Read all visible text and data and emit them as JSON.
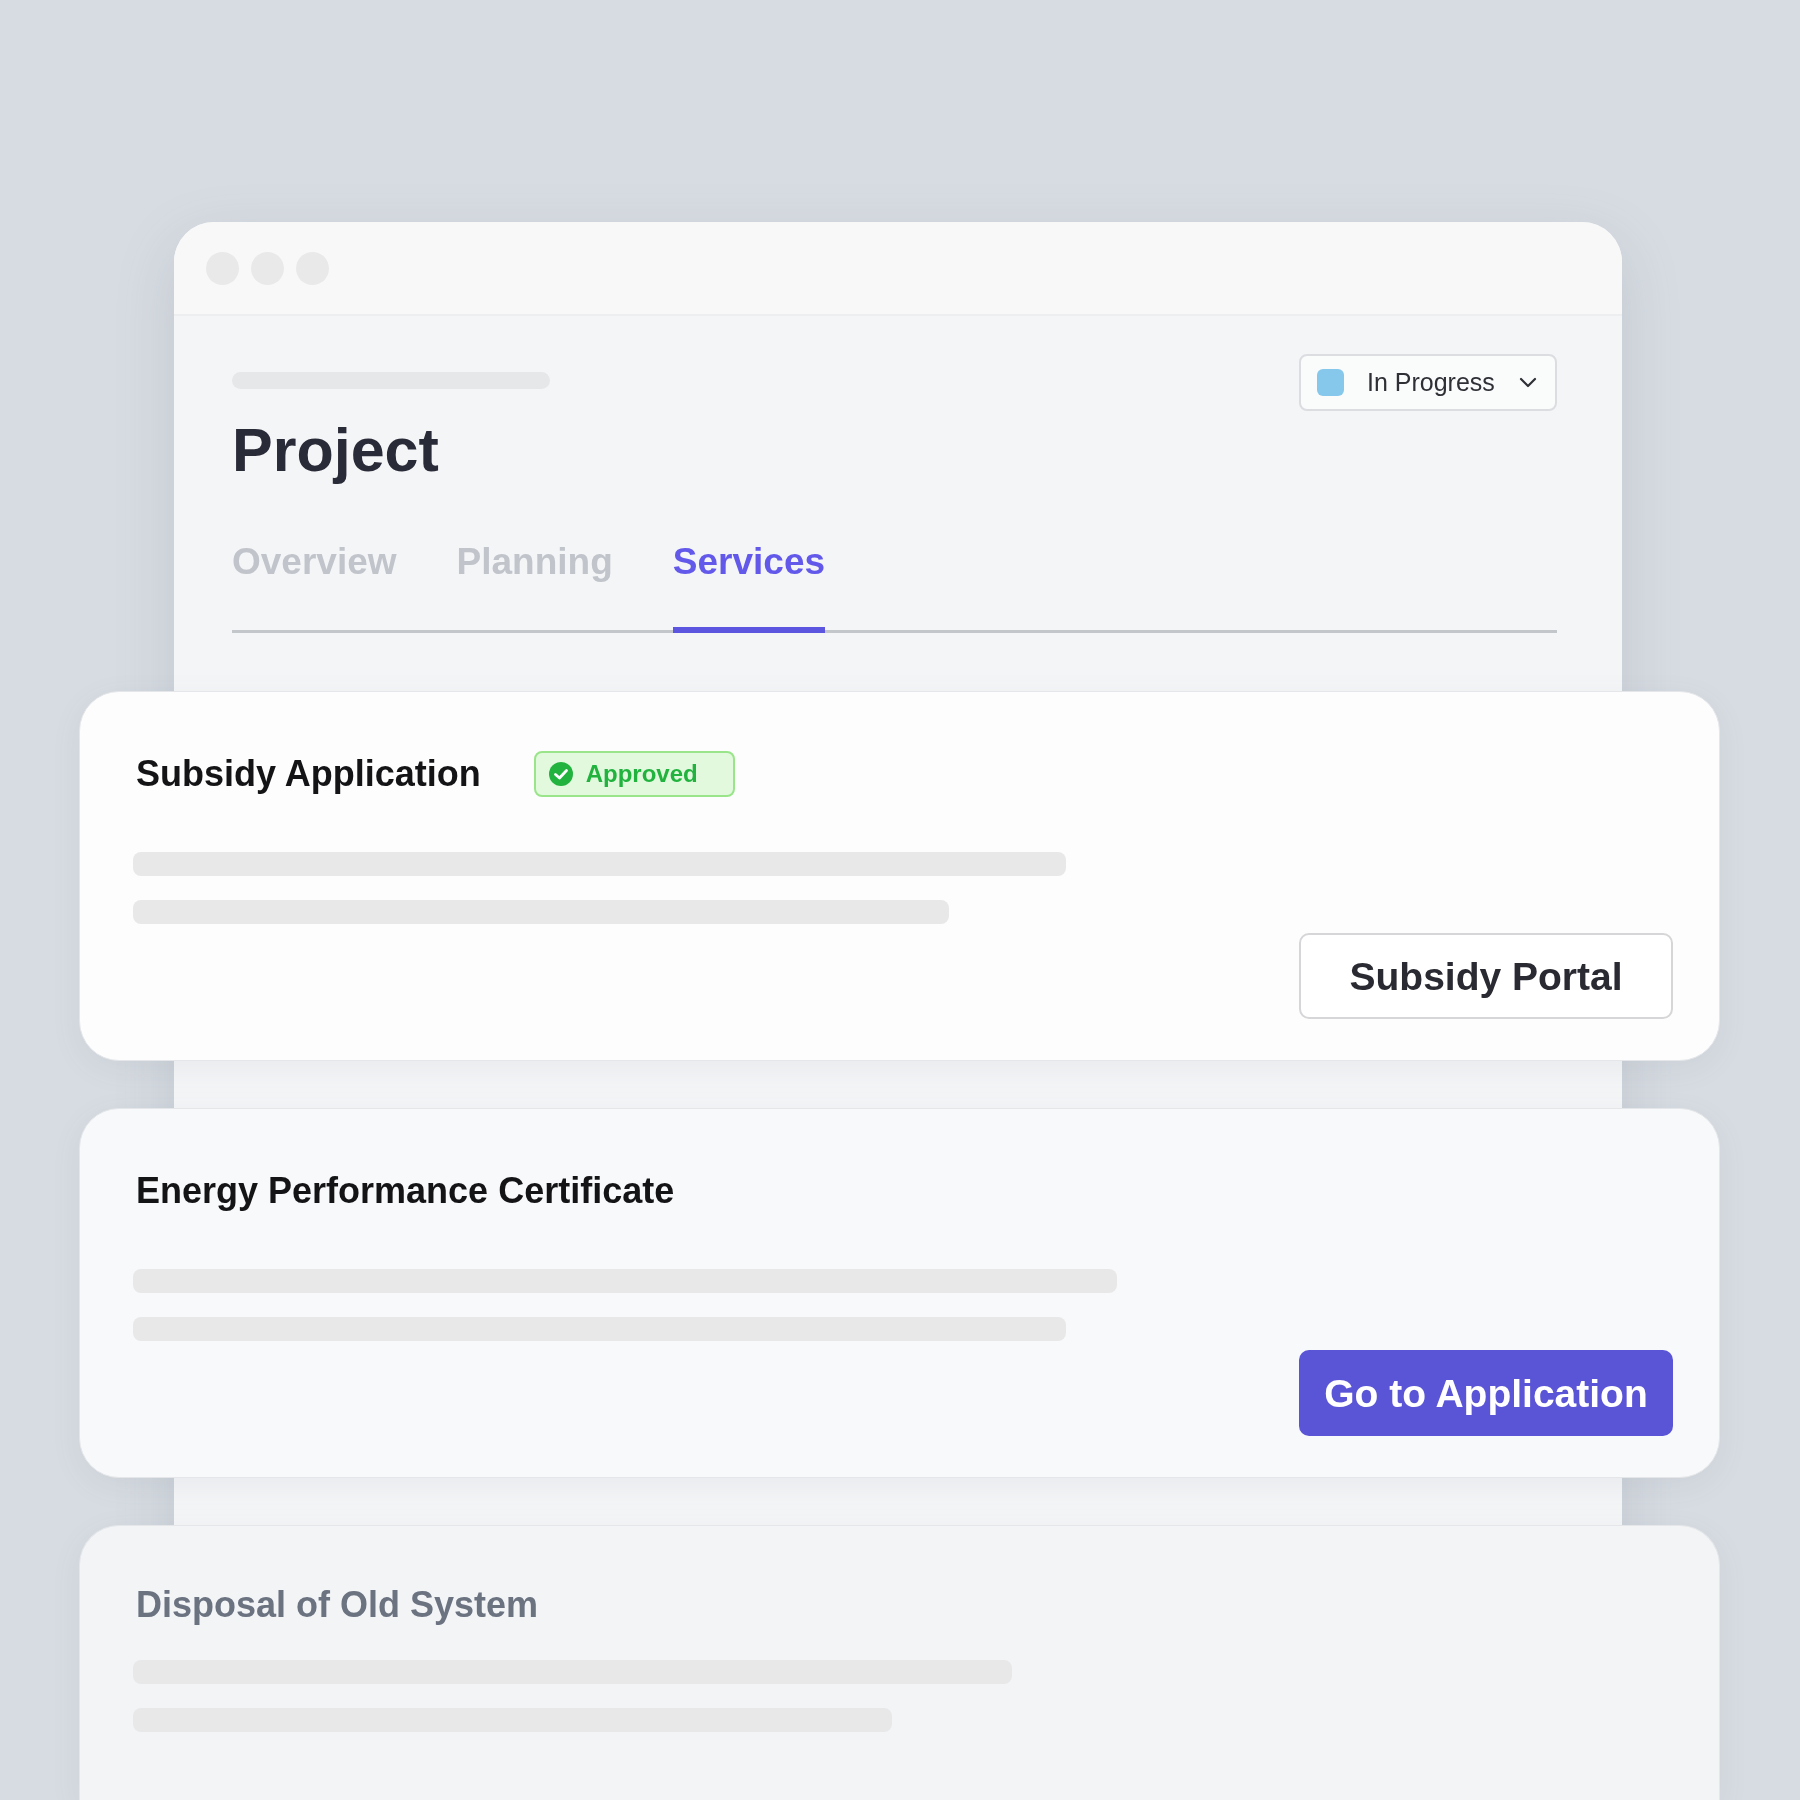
{
  "page": {
    "title": "Project",
    "status": {
      "label": "In Progress",
      "color": "#86c8ec"
    },
    "tabs": [
      {
        "label": "Overview",
        "selected": false
      },
      {
        "label": "Planning",
        "selected": false
      },
      {
        "label": "Services",
        "selected": true
      }
    ]
  },
  "services": [
    {
      "title": "Subsidy Application",
      "disabled": false,
      "badge": {
        "label": "Approved",
        "kind": "success"
      },
      "button": {
        "label": "Subsidy Portal",
        "kind": "secondary"
      }
    },
    {
      "title": "Energy Performance Certificate",
      "disabled": false,
      "button": {
        "label": "Go to Application",
        "kind": "primary"
      }
    },
    {
      "title": "Disposal of Old System",
      "disabled": true
    }
  ]
}
